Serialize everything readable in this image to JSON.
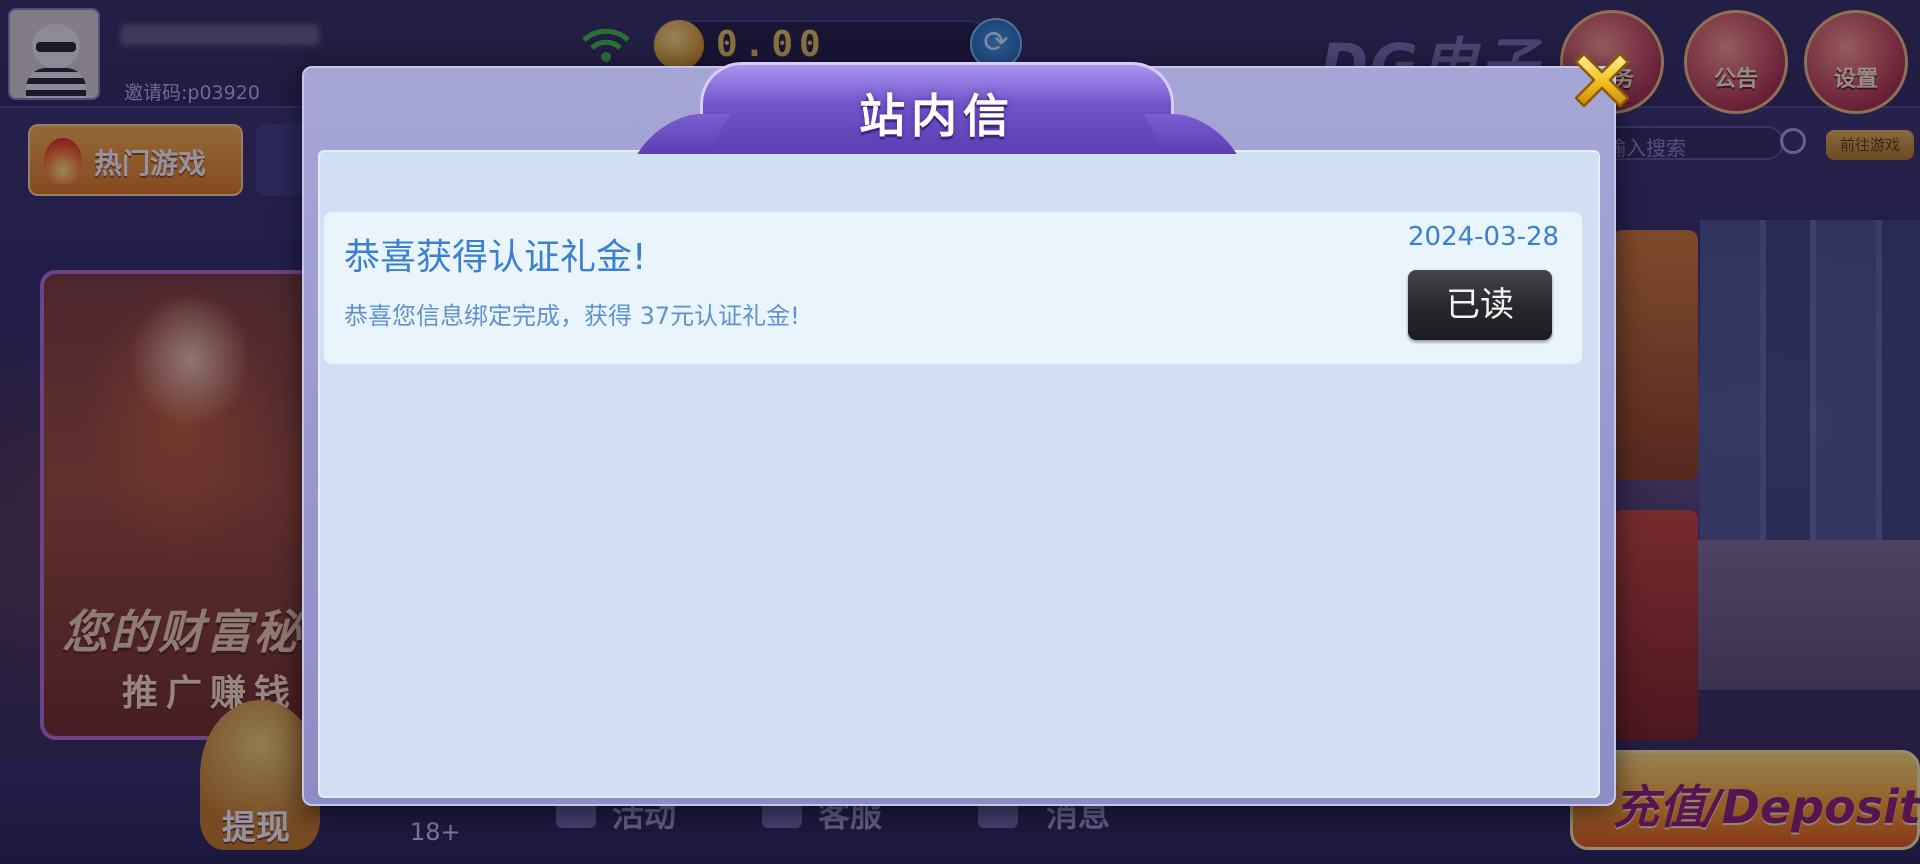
{
  "lobby": {
    "invite_code": "邀请码:p03920",
    "balance": "0.00",
    "brand": "DG电子",
    "top_buttons": [
      {
        "label": "任务",
        "icon": "task-icon"
      },
      {
        "label": "公告",
        "icon": "megaphone-icon"
      },
      {
        "label": "设置",
        "icon": "settings-cat-icon"
      }
    ],
    "search_placeholder": "请输入搜索",
    "find_game_label": "前往游戏",
    "hot_tab_label": "热门游戏",
    "promo_title": "您的财富秘",
    "promo_subtitle": "推广赚钱",
    "withdraw_label": "提现",
    "age_badge": "18+",
    "bottom_nav": [
      {
        "label": "活动",
        "icon": "activity-icon"
      },
      {
        "label": "客服",
        "icon": "customer-service-icon"
      },
      {
        "label": "消息",
        "icon": "message-icon"
      }
    ],
    "deposit_label": "充值/Deposit"
  },
  "modal": {
    "title": "站内信",
    "close_icon": "close-x-icon",
    "messages": [
      {
        "title": "恭喜获得认证礼金!",
        "date": "2024-03-28",
        "body": "恭喜您信息绑定完成，获得 37元认证礼金!",
        "status_label": "已读"
      }
    ]
  },
  "colors": {
    "accent_blue": "#3a80cf",
    "modal_body_bg": "#d0dff4",
    "card_bg": "#eaf4fd",
    "title_tab": "#7054c9",
    "read_button": "#26272b"
  }
}
